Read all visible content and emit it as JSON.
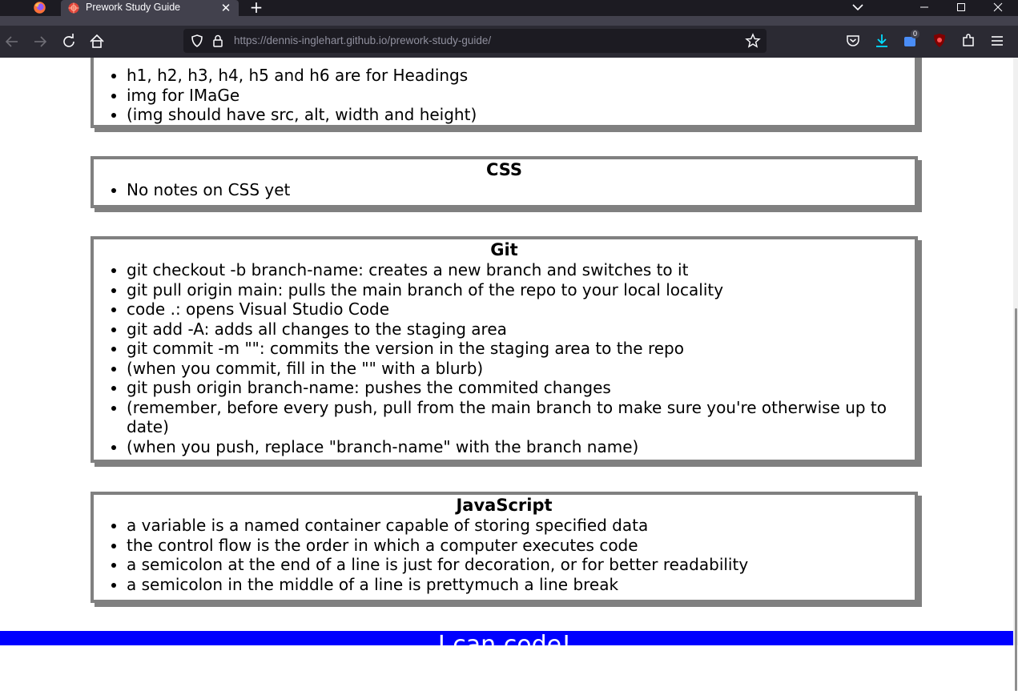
{
  "browser": {
    "tab_title": "Prework Study Guide",
    "tab_close": "✕",
    "new_tab": "+",
    "url_host": "https://dennis-inglehart.github.io",
    "url_path": "/prework-study-guide/",
    "window_controls": {
      "minimize": "—",
      "maximize": "☐",
      "close": "✕"
    },
    "extension_badge": "0",
    "colors": {
      "tabbar": "#1c1b22",
      "navbar": "#2b2a33",
      "accent": "#00ddff"
    }
  },
  "sections": {
    "html": {
      "items": [
        "h1, h2, h3, h4, h5 and h6 are for Headings",
        "img for IMaGe",
        "(img should have src, alt, width and height)"
      ]
    },
    "css": {
      "title": "CSS",
      "items": [
        "No notes on CSS yet"
      ]
    },
    "git": {
      "title": "Git",
      "items": [
        "git checkout -b branch-name: creates a new branch and switches to it",
        "git pull origin main: pulls the main branch of the repo to your local locality",
        "code .: opens Visual Studio Code",
        "git add -A: adds all changes to the staging area",
        "git commit -m \"\": commits the version in the staging area to the repo",
        "(when you commit, fill in the \"\" with a blurb)",
        "git push origin branch-name: pushes the commited changes",
        "(remember, before every push, pull from the main branch to make sure you're otherwise up to date)",
        "(when you push, replace \"branch-name\" with the branch name)"
      ]
    },
    "javascript": {
      "title": "JavaScript",
      "items": [
        "a variable is a named container capable of storing specified data",
        "the control flow is the order in which a computer executes code",
        "a semicolon at the end of a line is just for decoration, or for better readability",
        "a semicolon in the middle of a line is prettymuch a line break"
      ]
    }
  },
  "footer": {
    "text": "I can code!",
    "color": "#0000ff"
  }
}
